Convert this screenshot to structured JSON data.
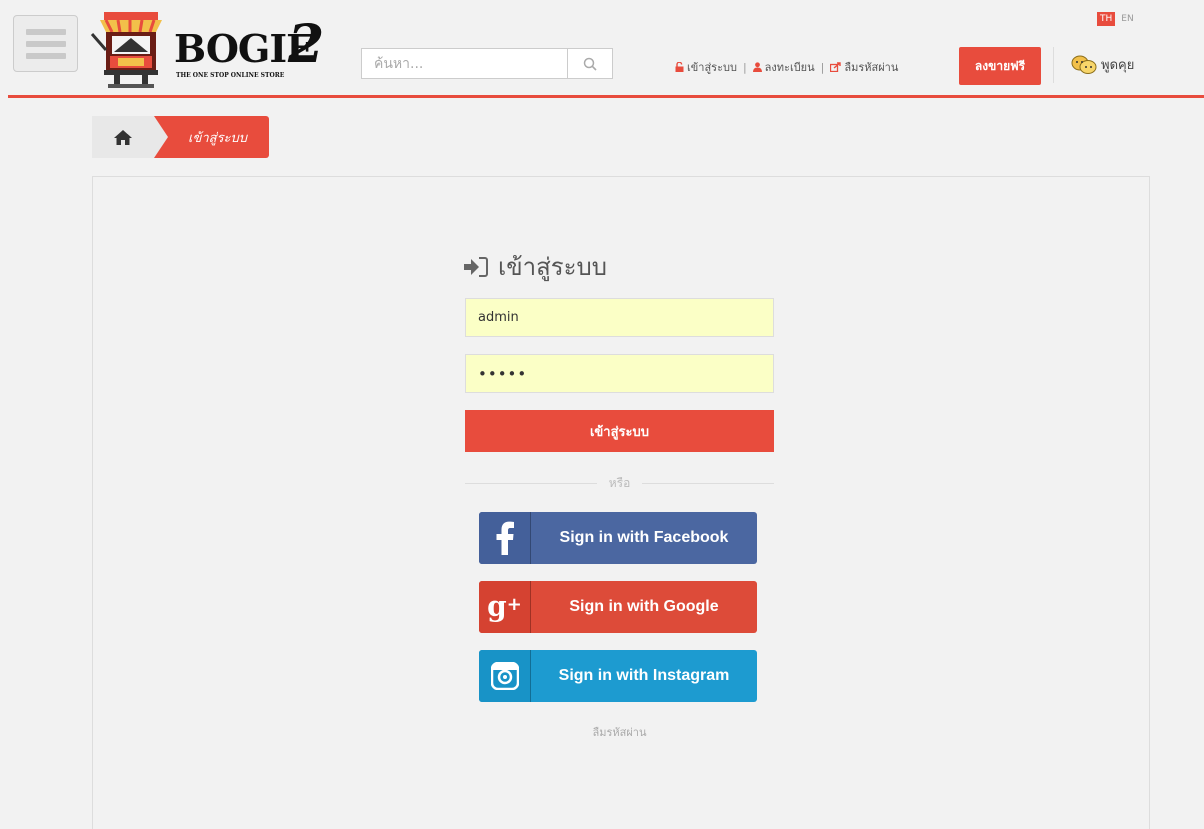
{
  "header": {
    "logo": {
      "word": "BOGIE",
      "number": "2",
      "tagline": "THE ONE STOP ONLINE STORE"
    },
    "search": {
      "placeholder": "ค้นหา..."
    },
    "links": {
      "login": "เข้าสู่ระบบ",
      "register": "ลงทะเบียน",
      "forgot": "ลืมรหัสผ่าน",
      "separator": "|"
    },
    "lang": {
      "th": "TH",
      "en": "EN"
    },
    "sell_button": "ลงขายฟรี",
    "chat": "พูดคุย"
  },
  "breadcrumb": {
    "current": "เข้าสู่ระบบ"
  },
  "login": {
    "title": "เข้าสู่ระบบ",
    "username_value": "admin",
    "password_value": "•••••",
    "submit_label": "เข้าสู่ระบบ",
    "or_label": "หรือ",
    "facebook_label": "Sign in with Facebook",
    "google_label": "Sign in with Google",
    "instagram_label": "Sign in with Instagram",
    "forgot_label": "ลืมรหัสผ่าน"
  },
  "colors": {
    "accent": "#e84c3d",
    "facebook": "#4b67a1",
    "google": "#dd4b39",
    "instagram": "#1d9bd0",
    "input_bg": "#fbffc6"
  }
}
